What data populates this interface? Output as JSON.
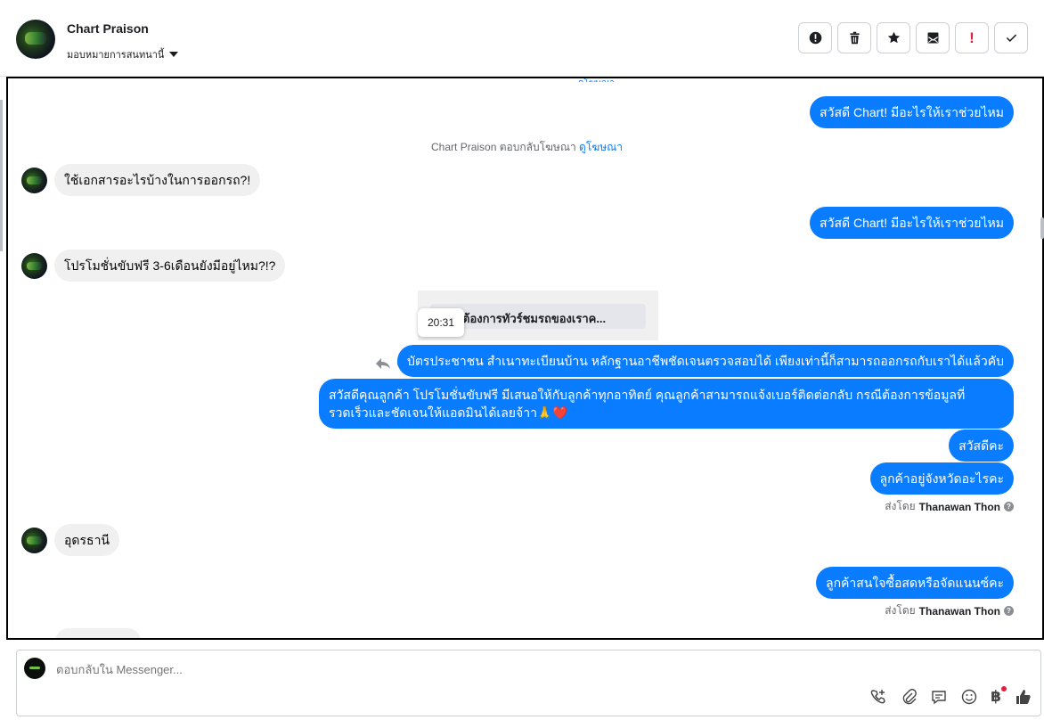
{
  "header": {
    "contact_name": "Chart Praison",
    "assign_label": "มอบหมายการสนทนานี้",
    "actions": [
      "mark-spam",
      "delete",
      "star",
      "mark-unread",
      "priority",
      "done"
    ]
  },
  "thread": {
    "top_cut_text": "ดูโฆษณา",
    "system_reply_text": "Chart Praison ตอบกลับโฆษณา",
    "system_reply_link": "ดูโฆษณา",
    "messages": [
      {
        "dir": "out",
        "text": "สวัสดี Chart! มีอะไรให้เราช่วยไหม"
      },
      {
        "dir": "in",
        "text": "ใช้เอกสารอะไรบ้างในการออกรถ?!"
      },
      {
        "dir": "out",
        "text": "สวัสดี Chart! มีอะไรให้เราช่วยไหม"
      },
      {
        "dir": "in",
        "text": "โปรโมชั่นขับฟรี 3-6เดือนยังมีอยู่ไหม?!?"
      },
      {
        "dir": "out",
        "text": "บัตรประชาชน สำเนาทะเบียนบ้าน หลักฐานอาชีพชัดเจนตรวจสอบได้ เพียงเท่านี้ก็สามารถออกรถกับเราได้แล้วคับ"
      },
      {
        "dir": "out",
        "text": "สวัสดีคุณลูกค้า โปรโมชั่นขับฟรี มีเสนอให้กับลูกค้าทุกอาทิตย์ คุณลูกค้าสามารถแจ้งเบอร์ติดต่อกลับ กรณีต้องการข้อมูลที่รวดเร็วและชัดเจนให้แอดมินได้เลยจ้าา🙏❤️"
      },
      {
        "dir": "out",
        "text": "สวัสดีคะ"
      },
      {
        "dir": "out",
        "text": "ลูกค้าอยู่จังหวัดอะไรคะ"
      },
      {
        "dir": "in",
        "text": "อุดรธานี"
      },
      {
        "dir": "out",
        "text": "ลูกค้าสนใจซื้อสดหรือจัดแนนซ์คะ"
      }
    ],
    "ad_card_button": "ต้องการทัวร์ชมรถของเราค...",
    "tooltip_time": "20:31",
    "sent_by_prefix": "ส่งโดย",
    "sent_by_name": "Thanawan Thon"
  },
  "composer": {
    "placeholder": "ตอบกลับใน Messenger...",
    "tools": [
      "call-add-icon",
      "attach-icon",
      "quick-reply-icon",
      "emoji-icon",
      "baht-icon",
      "thumbs-up-icon"
    ]
  }
}
